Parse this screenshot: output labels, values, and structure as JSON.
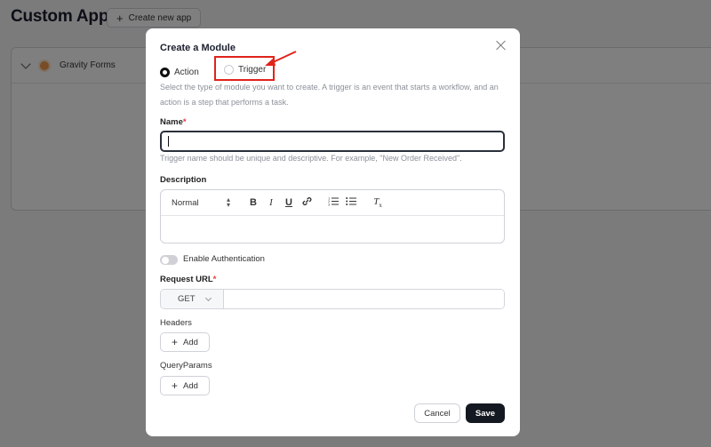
{
  "background": {
    "title": "Custom Apps",
    "create_button": "Create new app",
    "apps": [
      {
        "name": "Gravity Forms"
      }
    ]
  },
  "modal": {
    "title": "Create a Module",
    "module_type": {
      "options": [
        "Action",
        "Trigger"
      ],
      "selected": "Action",
      "help": "Select the type of module you want to create. A trigger is an event that starts a workflow, and an action is a step that performs a task."
    },
    "name": {
      "label": "Name",
      "required_mark": "*",
      "value": "",
      "help": "Trigger name should be unique and descriptive. For example, \"New Order Received\"."
    },
    "description": {
      "label": "Description",
      "format_select": "Normal",
      "toolbar_icons": [
        "bold-icon",
        "italic-icon",
        "underline-icon",
        "link-icon",
        "ordered-list-icon",
        "bullet-list-icon",
        "clear-format-icon"
      ],
      "toolbar_glyphs": {
        "bold": "B",
        "italic": "I",
        "underline": "U",
        "clear": "T"
      }
    },
    "authentication": {
      "label": "Enable Authentication",
      "enabled": false
    },
    "request_url": {
      "label": "Request URL",
      "required_mark": "*",
      "method": "GET",
      "value": ""
    },
    "headers": {
      "label": "Headers",
      "add_label": "Add"
    },
    "query_params": {
      "label": "QueryParams",
      "add_label": "Add"
    },
    "buttons": {
      "cancel": "Cancel",
      "save": "Save"
    }
  },
  "annotation": {
    "highlight_color": "#e0231b",
    "highlighted_option": "Trigger"
  }
}
